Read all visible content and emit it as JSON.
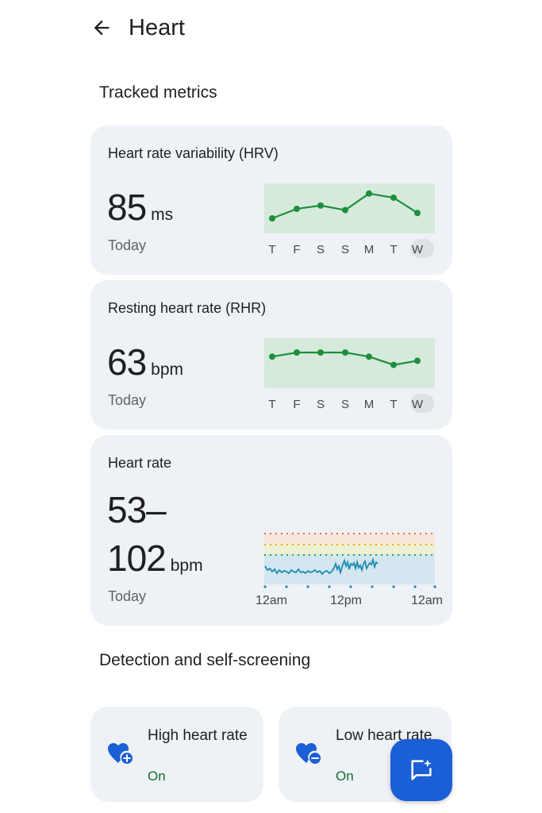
{
  "header": {
    "title": "Heart"
  },
  "tracked_metrics": {
    "heading": "Tracked metrics",
    "hrv": {
      "title": "Heart rate variability (HRV)",
      "value": "85",
      "unit": "ms",
      "period": "Today",
      "days": [
        "T",
        "F",
        "S",
        "S",
        "M",
        "T",
        "W"
      ],
      "selected_day_index": 6,
      "trend_relative": [
        0.25,
        0.48,
        0.56,
        0.45,
        0.85,
        0.75,
        0.38
      ]
    },
    "rhr": {
      "title": "Resting heart rate (RHR)",
      "value": "63",
      "unit": "bpm",
      "period": "Today",
      "days": [
        "T",
        "F",
        "S",
        "S",
        "M",
        "T",
        "W"
      ],
      "selected_day_index": 6,
      "trend_relative": [
        0.65,
        0.75,
        0.75,
        0.75,
        0.65,
        0.45,
        0.55
      ]
    },
    "heart_rate": {
      "title": "Heart rate",
      "value_line1": "53–",
      "value_line2": "102",
      "unit": "bpm",
      "period": "Today",
      "x_ticks": [
        "12am",
        "12pm",
        "12am"
      ]
    }
  },
  "detection": {
    "heading": "Detection and self-screening",
    "high": {
      "label": "High heart rate",
      "status": "On"
    },
    "low": {
      "label": "Low heart rate",
      "status": "On"
    }
  },
  "colors": {
    "accent_green": "#1e8e3e",
    "chart_bg_green": "#d5eadb",
    "status_green": "#146c2e",
    "heart_blue": "#1a5fd6",
    "line_blue": "#1a8cb0",
    "fab_blue": "#1a5fd6"
  },
  "icons": {
    "back": "arrow-left-icon",
    "high": "heart-plus-icon",
    "low": "heart-minus-icon",
    "fab": "chat-sparkle-icon"
  }
}
